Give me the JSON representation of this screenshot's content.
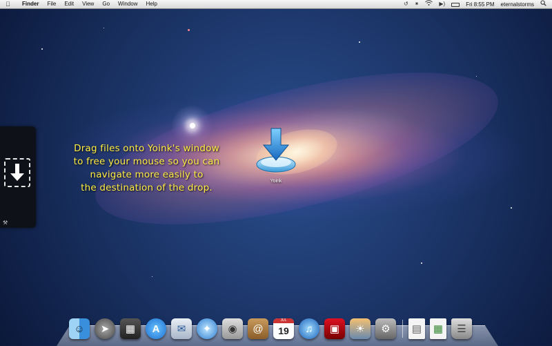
{
  "menubar": {
    "apple_icon": "apple-icon",
    "app_name": "Finder",
    "menus": [
      "File",
      "Edit",
      "View",
      "Go",
      "Window",
      "Help"
    ],
    "status_icons": [
      "time-machine-icon",
      "bluetooth-icon",
      "wifi-icon",
      "volume-icon"
    ],
    "datetime": "Fri 8:55 PM",
    "username": "eternalstorms",
    "spotlight_icon": "spotlight-search-icon"
  },
  "yoink_panel": {
    "drop_icon": "arrow-down-icon",
    "tools_icon": "tools-icon"
  },
  "instructions": {
    "lines": [
      "Drag files onto Yoink's window",
      "to free your mouse so you can",
      "navigate more easily to",
      "the destination of the drop."
    ],
    "color": "#ffee44"
  },
  "desktop_icon": {
    "label": "Yoink",
    "icon": "yoink-app-icon"
  },
  "dock": {
    "apps": [
      {
        "name": "finder-icon"
      },
      {
        "name": "launchpad-icon"
      },
      {
        "name": "mission-control-icon"
      },
      {
        "name": "app-store-icon"
      },
      {
        "name": "mail-icon"
      },
      {
        "name": "safari-icon"
      },
      {
        "name": "facetime-icon"
      },
      {
        "name": "address-book-icon"
      },
      {
        "name": "ical-icon",
        "month": "JUL",
        "day": "19"
      },
      {
        "name": "itunes-icon"
      },
      {
        "name": "photo-booth-icon"
      },
      {
        "name": "iphoto-icon"
      },
      {
        "name": "system-preferences-icon"
      }
    ],
    "stacks": [
      {
        "name": "documents-stack-icon"
      },
      {
        "name": "downloads-stack-icon"
      },
      {
        "name": "trash-icon"
      }
    ]
  }
}
